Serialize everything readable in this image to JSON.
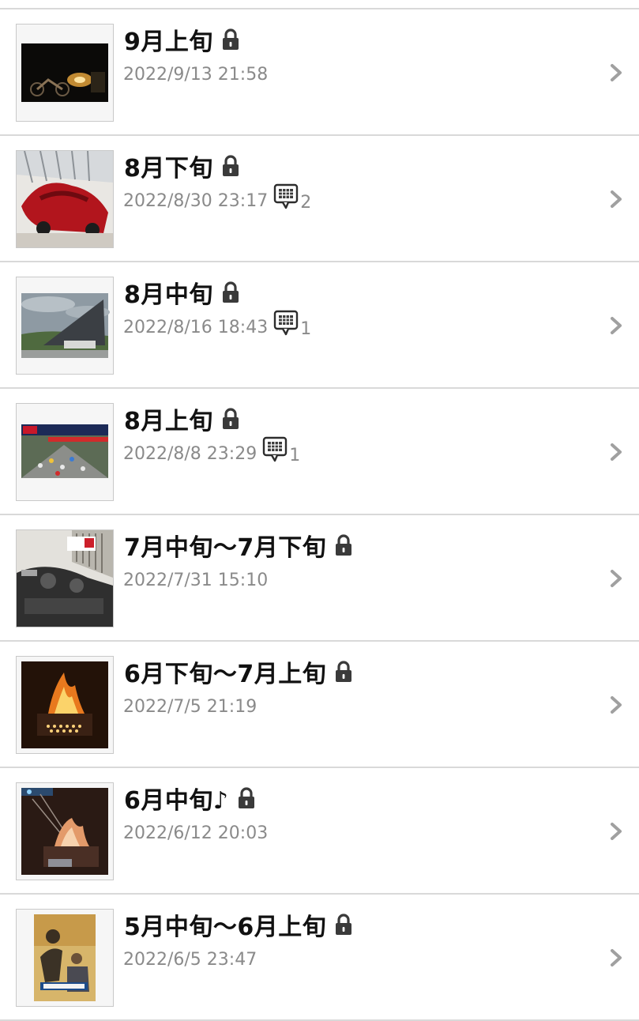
{
  "entries": [
    {
      "title": "9月上旬",
      "date": "2022/9/13 21:58",
      "comments": "",
      "thumb": "night-motorcycles"
    },
    {
      "title": "8月下旬",
      "date": "2022/8/30 23:17",
      "comments": "2",
      "thumb": "red-race-car"
    },
    {
      "title": "8月中旬",
      "date": "2022/8/16 18:43",
      "comments": "1",
      "thumb": "building-cloudy-sky"
    },
    {
      "title": "8月上旬",
      "date": "2022/8/8 23:29",
      "comments": "1",
      "thumb": "race-track-start"
    },
    {
      "title": "7月中旬～7月下旬",
      "date": "2022/7/31 15:10",
      "comments": "",
      "thumb": "motorcycle-handlebar"
    },
    {
      "title": "6月下旬～7月上旬",
      "date": "2022/7/5 21:19",
      "comments": "",
      "thumb": "bonfire-pit"
    },
    {
      "title": "6月中旬♪",
      "date": "2022/6/12 20:03",
      "comments": "",
      "thumb": "campfire-night"
    },
    {
      "title": "5月中旬～6月上旬",
      "date": "2022/6/5 23:47",
      "comments": "",
      "thumb": "movie-poster"
    }
  ],
  "icons": {
    "lock": "lock-icon",
    "comment": "comment-icon",
    "chevron": "chevron-right-icon"
  },
  "colors": {
    "title": "#111111",
    "meta": "#8a8a8a",
    "divider": "#d9d9d9",
    "chevron": "#a0a0a0"
  }
}
